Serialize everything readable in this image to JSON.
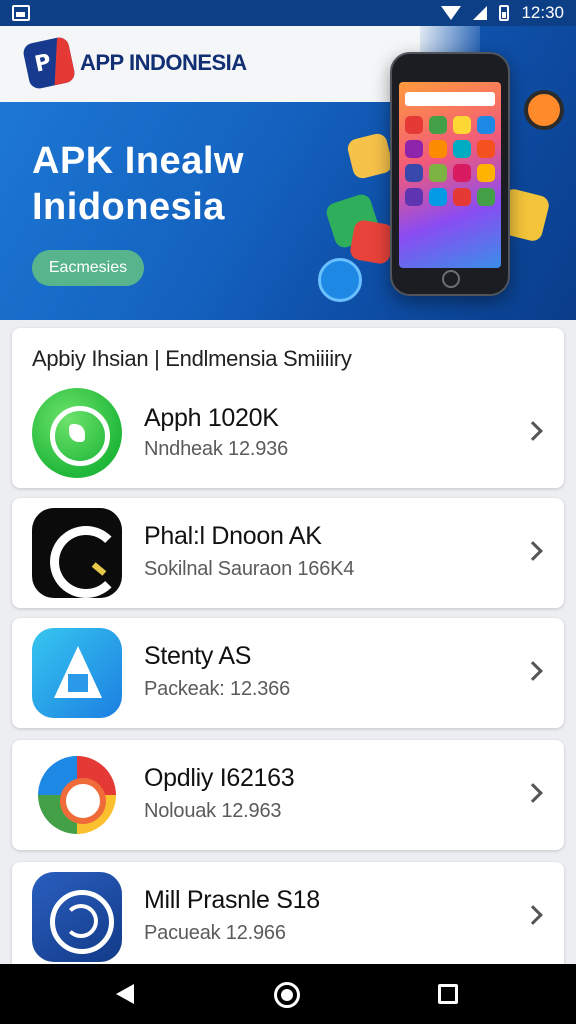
{
  "status_bar": {
    "time": "12:30"
  },
  "hero": {
    "logo_text": "APP INDONESIA",
    "title_line1": "APK Inealw",
    "title_line2": "Inidonesia",
    "button_label": "Eacmesies"
  },
  "list": {
    "section_title": "Apbiy Ihsian | Endlmensia Smiiiiry",
    "items": [
      {
        "name": "Apph 1020K",
        "subtitle": "Nndheak 12.936",
        "icon": "whatsapp-icon"
      },
      {
        "name": "Phal:l Dnoon AK",
        "subtitle": "Sokilnal Sauraon 166K4",
        "icon": "capcut-icon"
      },
      {
        "name": "Stenty AS",
        "subtitle": "Packeak: 12.366",
        "icon": "app-store-icon"
      },
      {
        "name": "Opdliy I62163",
        "subtitle": "Nolouak 12.963",
        "icon": "photos-icon"
      },
      {
        "name": "Mill Prasnle S18",
        "subtitle": "Pacueak 12.966",
        "icon": "spiral-app-icon"
      }
    ]
  },
  "nav": {
    "back": "back",
    "home": "home",
    "recents": "recents"
  }
}
